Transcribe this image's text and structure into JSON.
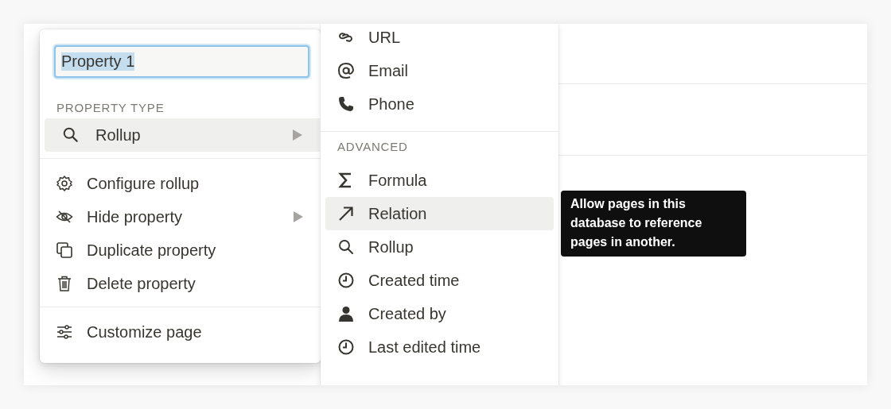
{
  "name_field": {
    "value": "Property 1",
    "text_selected": true
  },
  "property_type": {
    "heading": "PROPERTY TYPE",
    "current": {
      "label": "Rollup",
      "has_submenu": true,
      "selected": true
    }
  },
  "actions": [
    {
      "label": "Configure rollup",
      "has_submenu": false
    },
    {
      "label": "Hide property",
      "has_submenu": true
    },
    {
      "label": "Duplicate property",
      "has_submenu": false
    },
    {
      "label": "Delete property",
      "has_submenu": false
    }
  ],
  "customize": {
    "label": "Customize page"
  },
  "type_menu": {
    "basic_items": [
      {
        "label": "URL",
        "selected": false
      },
      {
        "label": "Email",
        "selected": false
      },
      {
        "label": "Phone",
        "selected": false
      }
    ],
    "advanced": {
      "heading": "ADVANCED",
      "items": [
        {
          "label": "Formula",
          "selected": false
        },
        {
          "label": "Relation",
          "selected": true
        },
        {
          "label": "Rollup",
          "selected": false
        },
        {
          "label": "Created time",
          "selected": false
        },
        {
          "label": "Created by",
          "selected": false
        },
        {
          "label": "Last edited time",
          "selected": false
        }
      ]
    }
  },
  "tooltip": {
    "text": "Allow pages in this database to reference pages in another."
  }
}
